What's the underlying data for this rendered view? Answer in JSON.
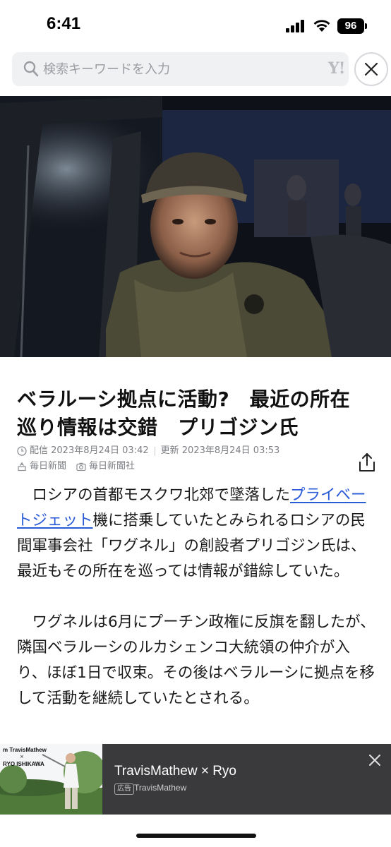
{
  "status_bar": {
    "time": "6:41",
    "battery": "96"
  },
  "search": {
    "placeholder": "検索キーワードを入力",
    "logo": "Y!"
  },
  "article": {
    "title_line1": "ベラルーシ拠点に活動?　最近の所在",
    "title_line2": "巡り情報は交錯　プリゴジン氏",
    "published": "配信 2023年8月24日 03:42",
    "updated": "更新 2023年8月24日 03:53",
    "source": "毎日新聞",
    "photo_credit": "毎日新聞社",
    "p1_before": "ロシアの首都モスクワ北郊で墜落した",
    "p1_link": "プライベートジェット",
    "p1_after": "機に搭乗していたとみられるロシアの民間軍事会社「ワグネル」の創設者プリゴジン氏は、最近もその所在を巡っては情報が錯綜していた。",
    "p2": "ワグネルは6月にプーチン政権に反旗を翻したが、隣国ベラルーシのルカシェンコ大統領の仲介が入り、ほぼ1日で収束。その後はベラルーシに拠点を移して活動を継続していたとされる。"
  },
  "ad": {
    "title": "TravisMathew × Ryo",
    "badge": "広告",
    "sponsor": "TravisMathew",
    "image_brand": "m  TravisMathew",
    "image_cross": "×",
    "image_name": "RYO ISHIKAWA"
  },
  "colors": {
    "link": "#2a5bd7",
    "ad_background": "#3a3a3c",
    "search_background": "#f0f1f3"
  }
}
